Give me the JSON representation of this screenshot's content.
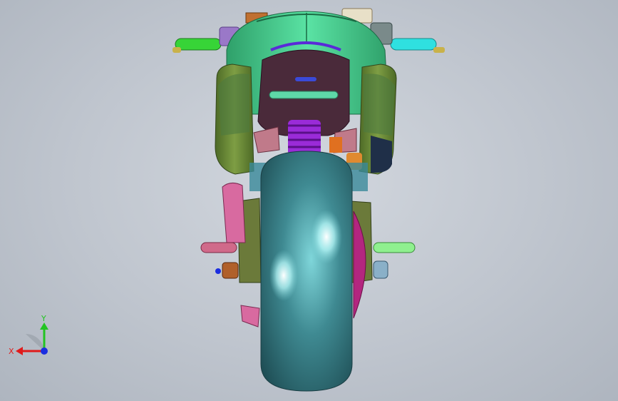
{
  "viewport": {
    "background_top": "#c9ced6",
    "background_bottom": "#aeb5bf"
  },
  "model": {
    "description_icon": "motorcycle-rear-view-3d-model",
    "colors": {
      "tire": "#3f8a92",
      "tire_highlight": "#e8ffff",
      "fairing": "#4fd99a",
      "fairing_dark": "#2fa06a",
      "seat_cowl": "#6f8f3a",
      "tail_panel": "#4a2a3a",
      "spring": "#9a2bd8",
      "brake_disc": "#b3267f",
      "left_grip": "#37d437",
      "right_grip": "#2fe0e0",
      "left_peg": "#d06a8a",
      "right_peg": "#8ff08f",
      "swingarm": "#6b7a3a",
      "exhaust": "#d86aa0"
    }
  },
  "triad": {
    "x_label": "X",
    "y_label": "Y",
    "x_color": "#e01b1b",
    "y_color": "#22c422",
    "z_color": "#1b2ee0"
  }
}
